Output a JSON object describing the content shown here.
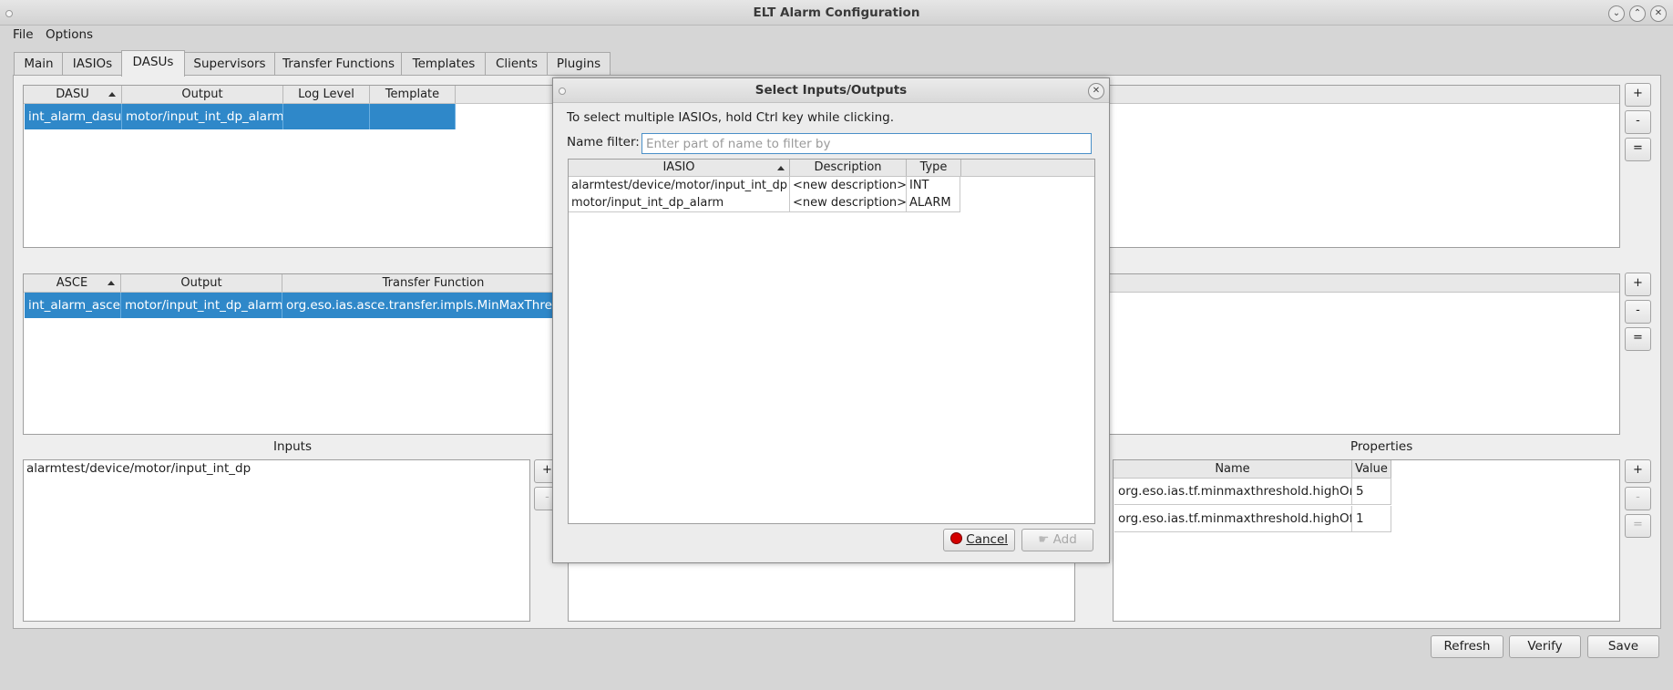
{
  "window": {
    "title": "ELT Alarm Configuration"
  },
  "menu": {
    "file": "File",
    "options": "Options"
  },
  "tabs": [
    "Main",
    "IASIOs",
    "DASUs",
    "Supervisors",
    "Transfer Functions",
    "Templates",
    "Clients",
    "Plugins"
  ],
  "selected_tab": "DASUs",
  "dasu_table": {
    "headers": [
      "DASU",
      "Output",
      "Log Level",
      "Template"
    ],
    "row": [
      "int_alarm_dasu",
      "motor/input_int_dp_alarm",
      "",
      ""
    ]
  },
  "asce_table": {
    "headers": [
      "ASCE",
      "Output",
      "Transfer Function"
    ],
    "row": [
      "int_alarm_asce",
      "motor/input_int_dp_alarm",
      "org.eso.ias.asce.transfer.impls.MinMaxThresho"
    ]
  },
  "side_buttons": {
    "add": "+",
    "remove": "-",
    "edit": "="
  },
  "inputs": {
    "label": "Inputs",
    "items": [
      "alarmtest/device/motor/input_int_dp"
    ]
  },
  "properties": {
    "label": "Properties",
    "headers": [
      "Name",
      "Value"
    ],
    "rows": [
      [
        "org.eso.ias.tf.minmaxthreshold.highOn",
        "5"
      ],
      [
        "org.eso.ias.tf.minmaxthreshold.highOff",
        "1"
      ]
    ]
  },
  "bottom_buttons": {
    "refresh": "Refresh",
    "verify": "Verify",
    "save": "Save"
  },
  "dialog": {
    "title": "Select Inputs/Outputs",
    "hint": "To select multiple IASIOs, hold Ctrl key while clicking.",
    "filter_label": "Name filter:",
    "filter_placeholder": "Enter part of name to filter by",
    "headers": [
      "IASIO",
      "Description",
      "Type"
    ],
    "rows": [
      [
        "alarmtest/device/motor/input_int_dp",
        "<new description>",
        "INT"
      ],
      [
        "motor/input_int_dp_alarm",
        "<new description>",
        "ALARM"
      ]
    ],
    "cancel_label": "Cancel",
    "add_label": "Add"
  },
  "colors": {
    "selection": "#2f88c9",
    "cancel_icon": "#d40000"
  }
}
